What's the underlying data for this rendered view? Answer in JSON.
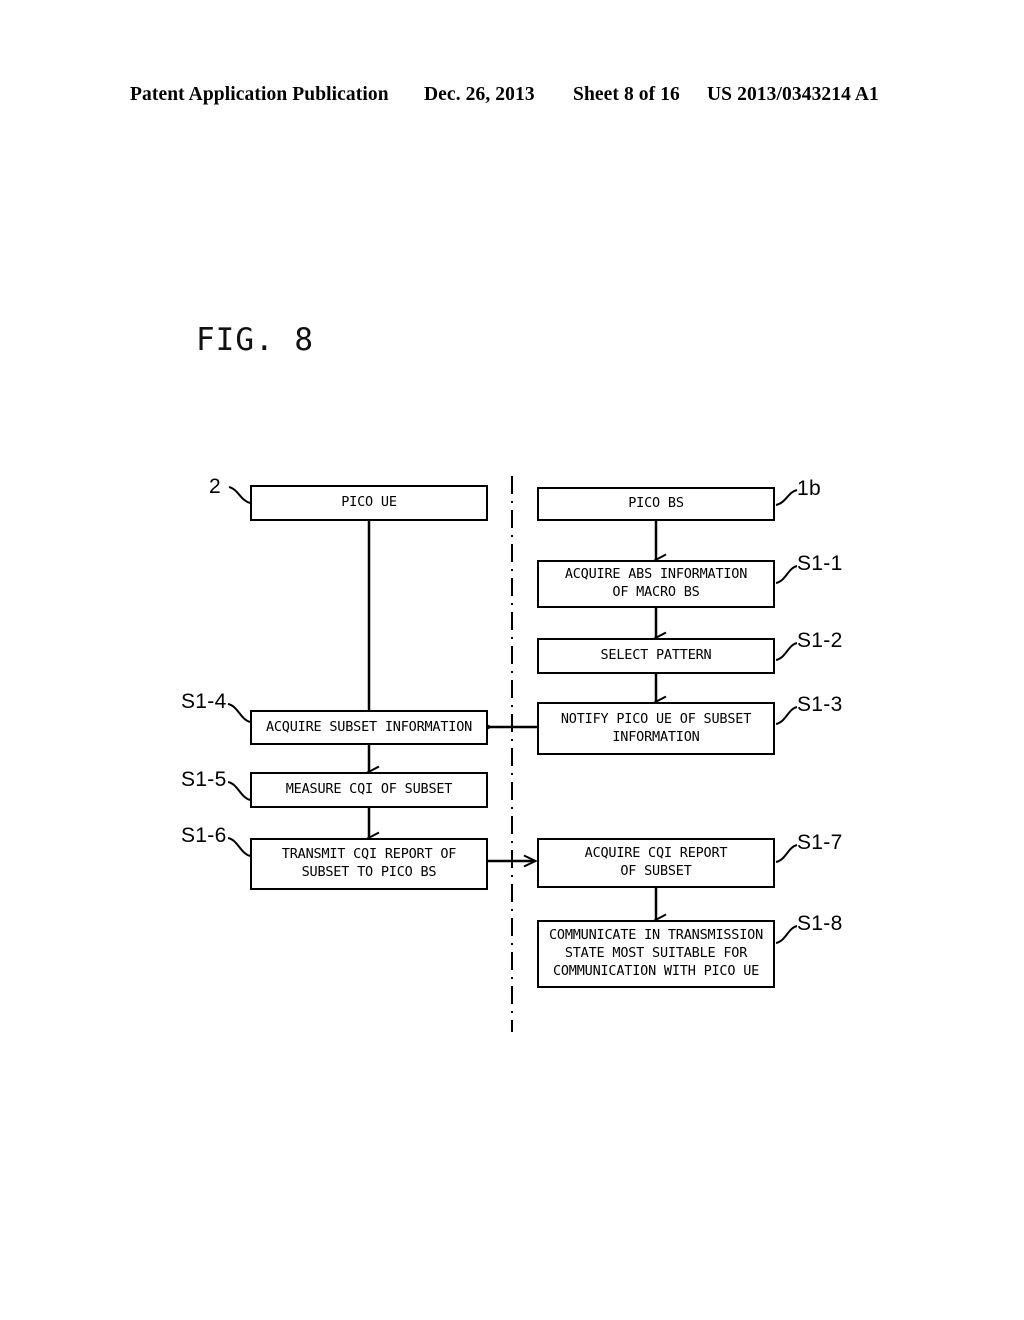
{
  "header": {
    "publication": "Patent Application Publication",
    "date": "Dec. 26, 2013",
    "sheet": "Sheet 8 of 16",
    "patent_number": "US 2013/0343214 A1"
  },
  "figure": {
    "label": "FIG. 8",
    "lanes": [
      {
        "id": "pico-ue",
        "title": "PICO UE",
        "ref": "2"
      },
      {
        "id": "pico-bs",
        "title": "PICO BS",
        "ref": "1b"
      }
    ],
    "steps": [
      {
        "id": "s1-1",
        "ref": "S1-1",
        "lane": "pico-bs",
        "text": "ACQUIRE ABS INFORMATION\nOF MACRO BS"
      },
      {
        "id": "s1-2",
        "ref": "S1-2",
        "lane": "pico-bs",
        "text": "SELECT PATTERN"
      },
      {
        "id": "s1-3",
        "ref": "S1-3",
        "lane": "pico-bs",
        "text": "NOTIFY PICO UE OF SUBSET\nINFORMATION"
      },
      {
        "id": "s1-4",
        "ref": "S1-4",
        "lane": "pico-ue",
        "text": "ACQUIRE SUBSET INFORMATION"
      },
      {
        "id": "s1-5",
        "ref": "S1-5",
        "lane": "pico-ue",
        "text": "MEASURE CQI OF SUBSET"
      },
      {
        "id": "s1-6",
        "ref": "S1-6",
        "lane": "pico-ue",
        "text": "TRANSMIT CQI REPORT OF\nSUBSET TO PICO BS"
      },
      {
        "id": "s1-7",
        "ref": "S1-7",
        "lane": "pico-bs",
        "text": "ACQUIRE CQI REPORT\nOF SUBSET"
      },
      {
        "id": "s1-8",
        "ref": "S1-8",
        "lane": "pico-bs",
        "text": "COMMUNICATE IN TRANSMISSION\nSTATE MOST SUITABLE FOR\nCOMMUNICATION WITH PICO UE"
      }
    ]
  },
  "colors": {
    "ink": "#000000",
    "paper": "#ffffff"
  }
}
